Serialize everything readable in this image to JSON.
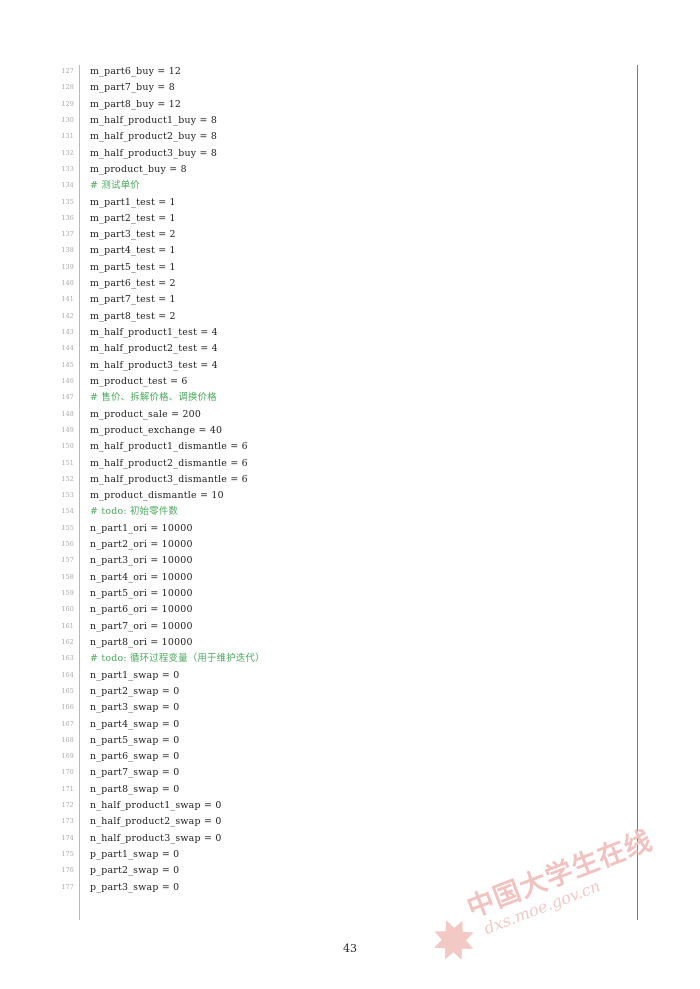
{
  "document": {
    "page_number": "43",
    "language": "python"
  },
  "watermark": {
    "logo_glyph": "✸",
    "organization": "中国大学生在线",
    "url": "dxs.moe.gov.cn",
    "color": "#f0c3c0"
  },
  "colors": {
    "code_text": "#1d1d1d",
    "comment_green": "#4aa85c",
    "line_number": "#a8a8ac",
    "gutter_rule": "#b9b9bd",
    "frame_rule": "#7c7c80"
  },
  "listing": {
    "lines": [
      {
        "n": "127",
        "text": "m_part6_buy = 12",
        "comment": false
      },
      {
        "n": "128",
        "text": "m_part7_buy = 8",
        "comment": false
      },
      {
        "n": "129",
        "text": "m_part8_buy = 12",
        "comment": false
      },
      {
        "n": "130",
        "text": "m_half_product1_buy = 8",
        "comment": false
      },
      {
        "n": "131",
        "text": "m_half_product2_buy = 8",
        "comment": false
      },
      {
        "n": "132",
        "text": "m_half_product3_buy = 8",
        "comment": false
      },
      {
        "n": "133",
        "text": "m_product_buy = 8",
        "comment": false
      },
      {
        "n": "134",
        "text": "# 测试单价",
        "comment": true
      },
      {
        "n": "135",
        "text": "m_part1_test = 1",
        "comment": false
      },
      {
        "n": "136",
        "text": "m_part2_test = 1",
        "comment": false
      },
      {
        "n": "137",
        "text": "m_part3_test = 2",
        "comment": false
      },
      {
        "n": "138",
        "text": "m_part4_test = 1",
        "comment": false
      },
      {
        "n": "139",
        "text": "m_part5_test = 1",
        "comment": false
      },
      {
        "n": "140",
        "text": "m_part6_test = 2",
        "comment": false
      },
      {
        "n": "141",
        "text": "m_part7_test = 1",
        "comment": false
      },
      {
        "n": "142",
        "text": "m_part8_test = 2",
        "comment": false
      },
      {
        "n": "143",
        "text": "m_half_product1_test = 4",
        "comment": false
      },
      {
        "n": "144",
        "text": "m_half_product2_test = 4",
        "comment": false
      },
      {
        "n": "145",
        "text": "m_half_product3_test = 4",
        "comment": false
      },
      {
        "n": "146",
        "text": "m_product_test = 6",
        "comment": false
      },
      {
        "n": "147",
        "text": "# 售价、拆解价格、调换价格",
        "comment": true
      },
      {
        "n": "148",
        "text": "m_product_sale = 200",
        "comment": false
      },
      {
        "n": "149",
        "text": "m_product_exchange = 40",
        "comment": false
      },
      {
        "n": "150",
        "text": "m_half_product1_dismantle = 6",
        "comment": false
      },
      {
        "n": "151",
        "text": "m_half_product2_dismantle = 6",
        "comment": false
      },
      {
        "n": "152",
        "text": "m_half_product3_dismantle = 6",
        "comment": false
      },
      {
        "n": "153",
        "text": "m_product_dismantle = 10",
        "comment": false
      },
      {
        "n": "154",
        "text": "# todo: 初始零件数",
        "comment": true
      },
      {
        "n": "155",
        "text": "n_part1_ori = 10000",
        "comment": false
      },
      {
        "n": "156",
        "text": "n_part2_ori = 10000",
        "comment": false
      },
      {
        "n": "157",
        "text": "n_part3_ori = 10000",
        "comment": false
      },
      {
        "n": "158",
        "text": "n_part4_ori = 10000",
        "comment": false
      },
      {
        "n": "159",
        "text": "n_part5_ori = 10000",
        "comment": false
      },
      {
        "n": "160",
        "text": "n_part6_ori = 10000",
        "comment": false
      },
      {
        "n": "161",
        "text": "n_part7_ori = 10000",
        "comment": false
      },
      {
        "n": "162",
        "text": "n_part8_ori = 10000",
        "comment": false
      },
      {
        "n": "163",
        "text": "# todo: 循环过程变量（用于维护迭代）",
        "comment": true
      },
      {
        "n": "164",
        "text": "n_part1_swap = 0",
        "comment": false
      },
      {
        "n": "165",
        "text": "n_part2_swap = 0",
        "comment": false
      },
      {
        "n": "166",
        "text": "n_part3_swap = 0",
        "comment": false
      },
      {
        "n": "167",
        "text": "n_part4_swap = 0",
        "comment": false
      },
      {
        "n": "168",
        "text": "n_part5_swap = 0",
        "comment": false
      },
      {
        "n": "169",
        "text": "n_part6_swap = 0",
        "comment": false
      },
      {
        "n": "170",
        "text": "n_part7_swap = 0",
        "comment": false
      },
      {
        "n": "171",
        "text": "n_part8_swap = 0",
        "comment": false
      },
      {
        "n": "172",
        "text": "n_half_product1_swap = 0",
        "comment": false
      },
      {
        "n": "173",
        "text": "n_half_product2_swap = 0",
        "comment": false
      },
      {
        "n": "174",
        "text": "n_half_product3_swap = 0",
        "comment": false
      },
      {
        "n": "175",
        "text": "p_part1_swap = 0",
        "comment": false
      },
      {
        "n": "176",
        "text": "p_part2_swap = 0",
        "comment": false
      },
      {
        "n": "177",
        "text": "p_part3_swap = 0",
        "comment": false
      }
    ]
  }
}
